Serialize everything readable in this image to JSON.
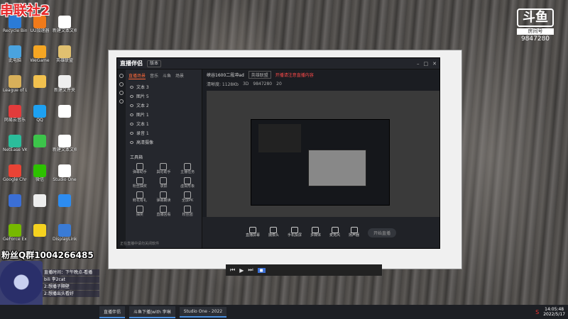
{
  "overlay": {
    "logo": "串联社2",
    "fans": "粉丝Q群1004266485",
    "chat": [
      "直播时间：下午晚点-看播",
      "bili 李2cat",
      "2:想播子隔壁",
      "2:想播出头看好"
    ]
  },
  "watermark": {
    "brand": "斗鱼",
    "line1": "房间号",
    "room": "9847280"
  },
  "desktop": {
    "icons": [
      {
        "label": "Recycle Bin",
        "color": "#2b7bd6"
      },
      {
        "label": "UU加速器",
        "color": "#f07a1a"
      },
      {
        "label": "新建文本文档",
        "color": "#ffffff"
      },
      {
        "label": "此电脑",
        "color": "#4aa3df"
      },
      {
        "label": "WeGame",
        "color": "#f5a623"
      },
      {
        "label": "英雄联盟",
        "color": "#e0c070"
      },
      {
        "label": "League of Legends",
        "color": "#d8b05a"
      },
      {
        "label": "",
        "color": "#f2c14e"
      },
      {
        "label": "新建文件夹",
        "color": "#eeeeee"
      },
      {
        "label": "网易云音乐",
        "color": "#e23b3b"
      },
      {
        "label": "QQ",
        "color": "#1da1f2"
      },
      {
        "label": "",
        "color": "#ffffff"
      },
      {
        "label": "NetEase VK",
        "color": "#2bbd9b"
      },
      {
        "label": "",
        "color": "#3cc44a"
      },
      {
        "label": "新建文本文档",
        "color": "#ffffff"
      },
      {
        "label": "Google Chrome",
        "color": "#e94335"
      },
      {
        "label": "微信",
        "color": "#2dc100"
      },
      {
        "label": "Studio One",
        "color": "#ffffff"
      },
      {
        "label": "",
        "color": "#3b6fd6"
      },
      {
        "label": "",
        "color": "#eeeeee"
      },
      {
        "label": "",
        "color": "#2d8cf0"
      },
      {
        "label": "GeForce Experience",
        "color": "#76b900"
      },
      {
        "label": "",
        "color": "#f5d21f"
      },
      {
        "label": "DisplayLink",
        "color": "#3a7bd5"
      }
    ]
  },
  "app": {
    "title": "直播伴侣",
    "version": "版本",
    "scene_tabs": [
      "直播场景",
      "音乐",
      "斗鱼",
      "场景"
    ],
    "sources": [
      "文本 3",
      "图片 5",
      "文本 2",
      "图片 1",
      "文本 1",
      "录音 1",
      "高清摄像"
    ],
    "tools_header": "工具箱",
    "tools": [
      "弹幕助手",
      "舆论助手",
      "主播任务",
      "粉丝抽奖",
      "录屏",
      "虚拟形象",
      "鲜花有礼",
      "弹幕朗读",
      "全屏PK",
      "抽奖",
      "直播回看",
      "粉丝团"
    ],
    "room_title": "峡谷1600二段冲ad",
    "category": "英雄联盟",
    "warning": "开播请注意直播内容",
    "stats": [
      "清晰度: 1128Kb",
      "3D",
      "9847280",
      "20"
    ],
    "bottom_buttons": [
      "直播屏幕",
      "摄像头",
      "手机投屏",
      "多媒体",
      "麦克风",
      "扬声器"
    ],
    "start": "开始直播",
    "footer": "正在直播中请勿关闭软件"
  },
  "taskbar": {
    "items": [
      "直播伴侣",
      "斗鱼下播|with 李琳",
      "Studio One - 2022"
    ],
    "time": "14:05:48",
    "date": "2022/5/17"
  }
}
